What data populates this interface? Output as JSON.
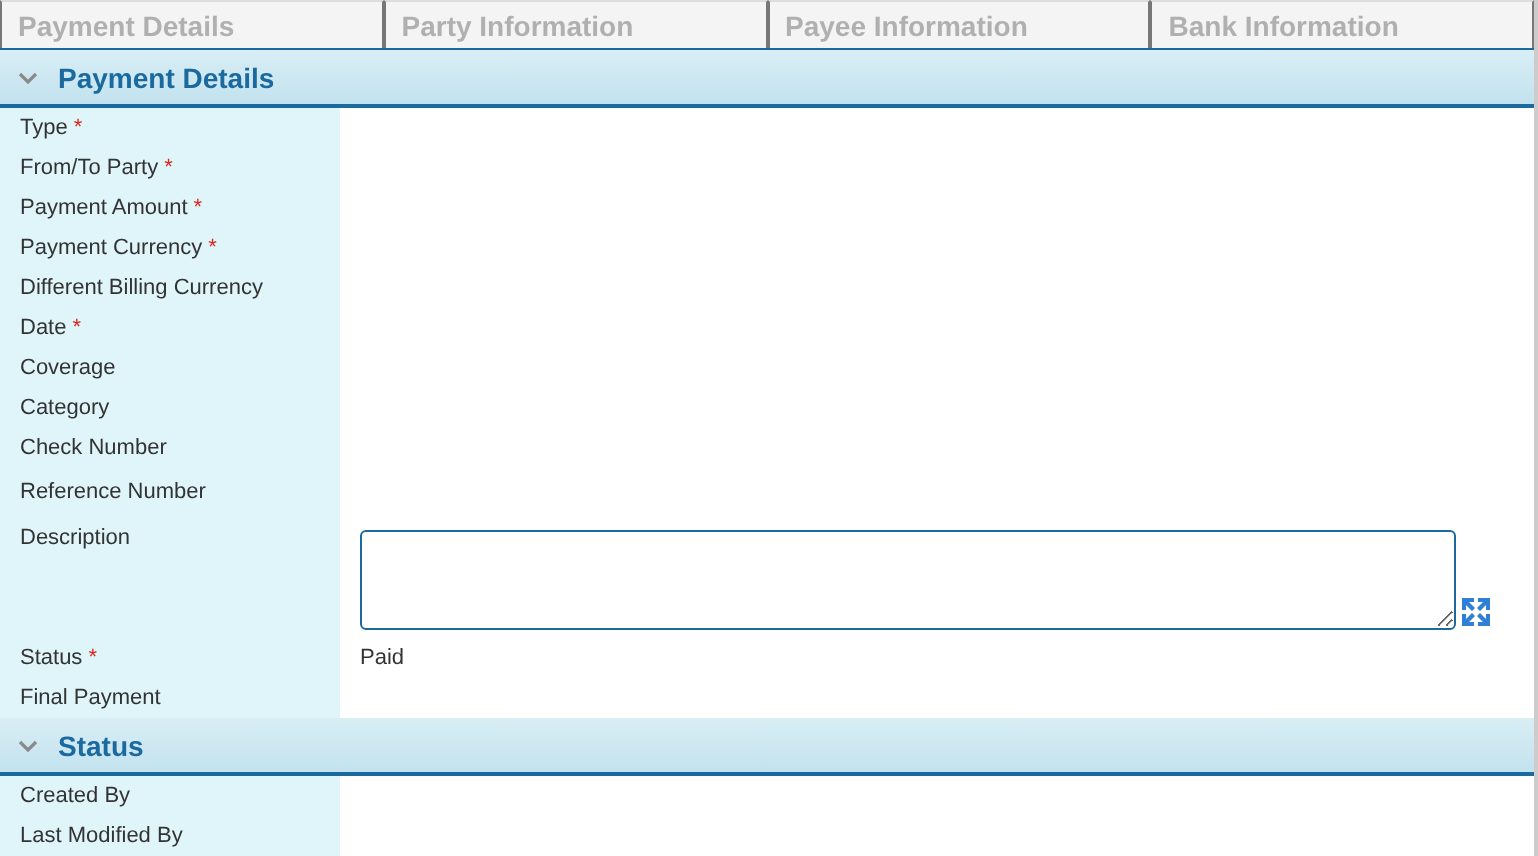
{
  "tabs": [
    {
      "label": "Payment Details",
      "selected": false
    },
    {
      "label": "Party Information",
      "selected": false
    },
    {
      "label": "Payee Information",
      "selected": false
    },
    {
      "label": "Bank Information",
      "selected": false
    }
  ],
  "sections": [
    {
      "title": "Payment Details",
      "expanded": true,
      "rows": [
        {
          "kind": "plain",
          "label": "Type",
          "required_mark": "*"
        },
        {
          "kind": "plain",
          "label": "From/To Party",
          "required_mark": "*"
        },
        {
          "kind": "plain",
          "label": "Payment Amount",
          "required_mark": "*"
        },
        {
          "kind": "plain",
          "label": "Payment Currency",
          "required_mark": "*"
        },
        {
          "kind": "plain",
          "label": "Different Billing Currency"
        },
        {
          "kind": "plain",
          "label": "Date",
          "required_mark": "*"
        },
        {
          "kind": "plain",
          "label": "Coverage"
        },
        {
          "kind": "plain",
          "label": "Category"
        },
        {
          "kind": "plain",
          "label": "Check Number"
        },
        {
          "kind": "plain",
          "label": "Reference Number"
        },
        {
          "kind": "textarea",
          "label": "Description"
        },
        {
          "kind": "value",
          "label": "Status",
          "required_mark": "*",
          "value": "Paid"
        },
        {
          "kind": "plain",
          "label": "Final Payment"
        }
      ]
    },
    {
      "title": "Status",
      "expanded": true,
      "rows": [
        {
          "kind": "plain",
          "label": "Created By"
        },
        {
          "kind": "plain",
          "label": "Last Modified By"
        }
      ]
    }
  ]
}
